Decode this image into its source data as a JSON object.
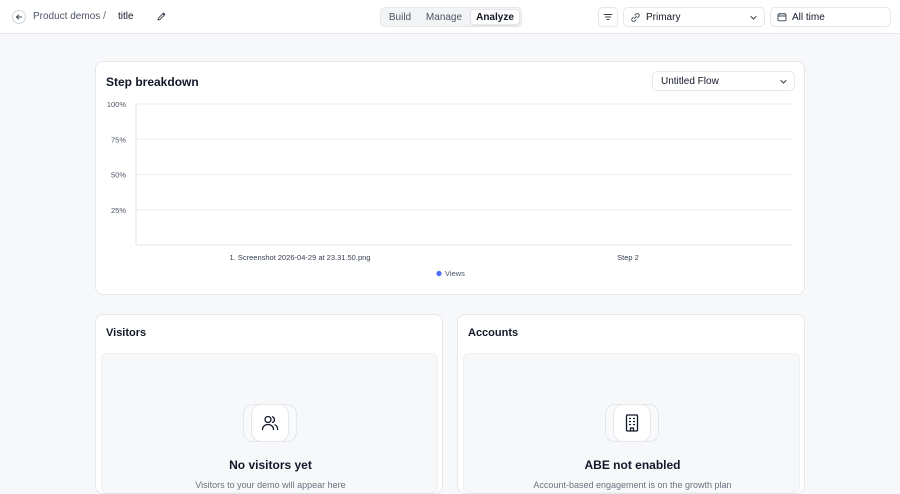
{
  "header": {
    "breadcrumb_parent": "Product demos",
    "breadcrumb_separator": "/",
    "title": "title",
    "tabs": [
      {
        "label": "Build",
        "active": false
      },
      {
        "label": "Manage",
        "active": false
      },
      {
        "label": "Analyze",
        "active": true
      }
    ],
    "variant_select": "Primary",
    "time_range": "All time"
  },
  "step_breakdown": {
    "title": "Step breakdown",
    "flow_select": "Untitled Flow"
  },
  "chart_data": {
    "type": "bar",
    "categories": [
      "1. Screenshot 2026-04-29 at 23.31.50.png",
      "Step 2"
    ],
    "series": [
      {
        "name": "Views",
        "values": [
          0,
          0
        ]
      }
    ],
    "y_ticks": [
      "100%",
      "75%",
      "50%",
      "25%"
    ],
    "ylim": [
      0,
      100
    ],
    "grid": true,
    "legend_position": "bottom",
    "colors": {
      "Views": "#4f6ef7"
    }
  },
  "visitors": {
    "title": "Visitors",
    "empty_title": "No visitors yet",
    "empty_subtitle": "Visitors to your demo will appear here"
  },
  "accounts": {
    "title": "Accounts",
    "empty_title": "ABE not enabled",
    "empty_subtitle": "Account-based engagement is on the growth plan"
  },
  "icons": {
    "back": "arrow-left-icon",
    "edit": "pencil-icon",
    "filter": "filter-icon",
    "variant": "link-icon",
    "calendar": "calendar-icon",
    "chevron": "chevron-down-icon",
    "visitors": "users-icon",
    "accounts": "building-icon"
  }
}
